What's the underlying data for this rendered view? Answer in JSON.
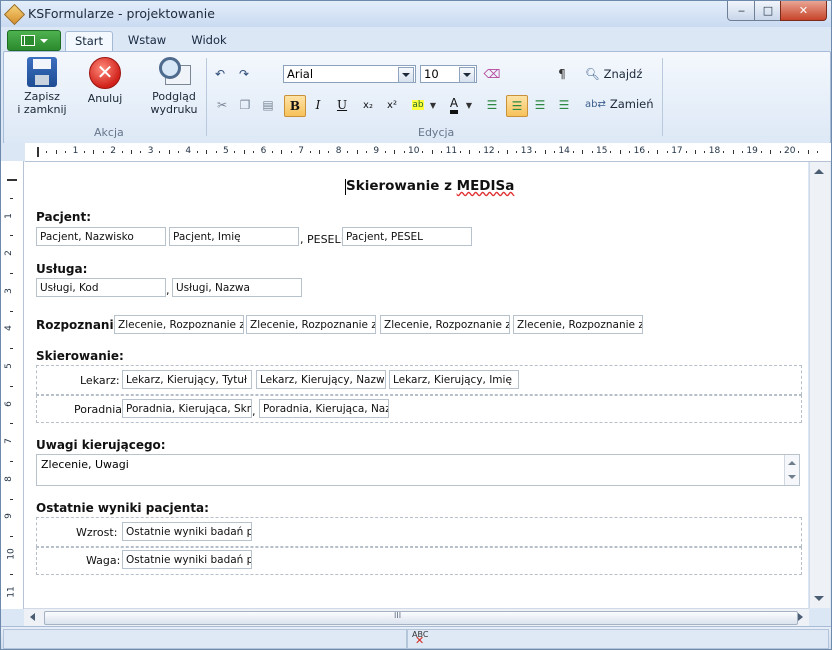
{
  "window": {
    "title": "KSFormularze - projektowanie",
    "controls": {
      "minimize": "‒",
      "maximize": "□",
      "close": "✕"
    }
  },
  "ribbon": {
    "tabs": [
      {
        "label": "Start",
        "active": true
      },
      {
        "label": "Wstaw",
        "active": false
      },
      {
        "label": "Widok",
        "active": false
      }
    ],
    "groups": {
      "akcja": {
        "label": "Akcja",
        "save": {
          "line1": "Zapisz",
          "line2": "i zamknij",
          "icon": "save-icon"
        },
        "cancel": {
          "label": "Anuluj",
          "icon": "cancel-icon"
        },
        "preview": {
          "line1": "Podgląd",
          "line2": "wydruku",
          "icon": "print-preview-icon"
        }
      },
      "edycja": {
        "label": "Edycja",
        "font_name": "Arial",
        "font_size": "10",
        "bold": "B",
        "italic": "I",
        "underline": "U",
        "subscript": "x₂",
        "superscript": "x²",
        "font_color_letter": "A",
        "paragraph": "¶",
        "find": "Znajdź",
        "replace": "Zamień"
      }
    }
  },
  "ruler": {
    "h_numbers": [
      "1",
      "2",
      "3",
      "4",
      "5",
      "6",
      "7",
      "8",
      "9",
      "10",
      "11",
      "12",
      "13",
      "14",
      "15",
      "16",
      "17",
      "18",
      "19",
      "20"
    ],
    "v_numbers": [
      "1",
      "2",
      "3",
      "4",
      "5",
      "6",
      "7",
      "8",
      "9",
      "10",
      "11"
    ]
  },
  "document": {
    "title_prefix": "Skierowanie z ",
    "title_word": "MEDISa",
    "pacjent": {
      "header": "Pacjent:",
      "nazwisko": "Pacjent, Nazwisko",
      "imie": "Pacjent, Imię",
      "pesel_label": ", PESEL:",
      "pesel": "Pacjent, PESEL"
    },
    "usluga": {
      "header": "Usługa:",
      "kod": "Usługi, Kod",
      "sep": ",",
      "nazwa": "Usługi, Nazwa"
    },
    "rozpoznania": {
      "header": "Rozpoznania:",
      "fields": [
        "Zlecenie, Rozpoznanie ze",
        "Zlecenie, Rozpoznanie ze",
        "Zlecenie, Rozpoznanie ze",
        "Zlecenie, Rozpoznanie ze"
      ]
    },
    "skierowanie": {
      "header": "Skierowanie:",
      "lekarz_label": "Lekarz:",
      "lekarz_fields": [
        "Lekarz, Kierujący, Tytuł",
        "Lekarz, Kierujący, Nazwis",
        "Lekarz, Kierujący, Imię"
      ],
      "poradnia_label": "Poradnia",
      "poradnia_fields": [
        "Poradnia, Kierująca, Skrót",
        "Poradnia, Kierująca, Nazw"
      ],
      "poradnia_sep": ","
    },
    "uwagi": {
      "header": "Uwagi kierującego:",
      "value": "Zlecenie, Uwagi"
    },
    "wyniki": {
      "header": "Ostatnie wyniki pacjenta:",
      "wzrost_label": "Wzrost:",
      "wzrost": "Ostatnie wyniki badań pac",
      "waga_label": "Waga:",
      "waga": "Ostatnie wyniki badań pac"
    }
  },
  "scrollbar": {
    "grip": "III"
  },
  "statusbar": {
    "spell_icon": "ABC"
  }
}
